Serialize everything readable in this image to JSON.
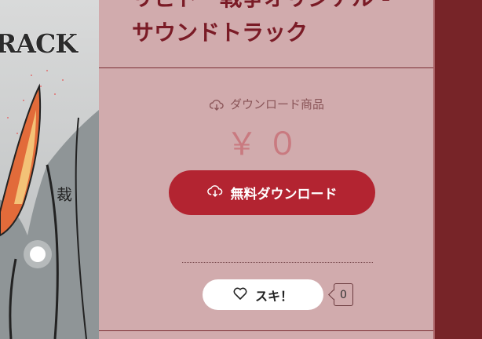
{
  "artwork": {
    "text": "RACK",
    "kanji": "裁"
  },
  "product": {
    "title": "リビドー戦争オリジナル・サウンドトラック",
    "title_line1": "リビドー戦争オリジナル -",
    "title_line2": "サウンドトラック",
    "type_label": "ダウンロード商品",
    "price": "￥０",
    "download_button": "無料ダウンロード"
  },
  "like": {
    "label": "スキ！",
    "count": "0"
  },
  "colors": {
    "button": "#b32431",
    "panel": "#d1abad",
    "sidebar": "#772428",
    "title": "#7a1b26"
  },
  "icons": {
    "download": "cloud-download-icon",
    "like": "heart-icon"
  }
}
